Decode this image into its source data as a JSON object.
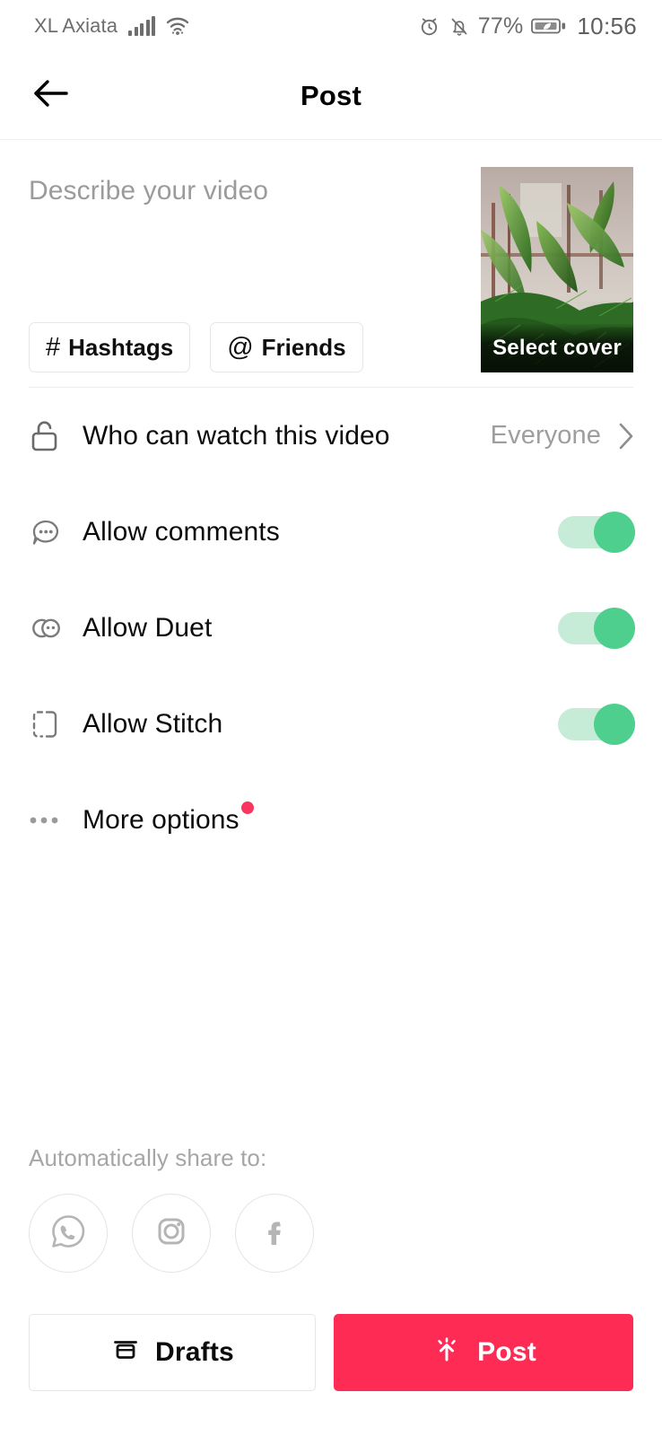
{
  "status_bar": {
    "carrier": "XL Axiata",
    "battery_percent": "77%",
    "time": "10:56",
    "icons": [
      "signal-bars-icon",
      "wifi-icon",
      "alarm-icon",
      "bell-muted-icon",
      "battery-saver-icon"
    ]
  },
  "header": {
    "title": "Post",
    "back_icon": "back-arrow-icon"
  },
  "compose": {
    "description_placeholder": "Describe your video",
    "description_value": "",
    "chips": [
      {
        "symbol": "#",
        "label": "Hashtags",
        "icon": "hashtag-icon"
      },
      {
        "symbol": "@",
        "label": "Friends",
        "icon": "at-mention-icon"
      }
    ],
    "cover": {
      "label": "Select cover",
      "icon": "video-thumbnail"
    }
  },
  "settings": {
    "rows": [
      {
        "label": "Who can watch this video",
        "icon": "unlock-icon",
        "type": "navigation",
        "value": "Everyone",
        "chevron": "chevron-right-icon"
      },
      {
        "label": "Allow comments",
        "icon": "comment-bubble-icon",
        "type": "toggle",
        "enabled": true
      },
      {
        "label": "Allow Duet",
        "icon": "duet-circles-icon",
        "type": "toggle",
        "enabled": true
      },
      {
        "label": "Allow Stitch",
        "icon": "stitch-bracket-icon",
        "type": "toggle",
        "enabled": true
      },
      {
        "label": "More options",
        "icon": "ellipsis-icon",
        "type": "navigation",
        "badge": true
      }
    ]
  },
  "share": {
    "title": "Automatically share to:",
    "targets": [
      {
        "name": "whatsapp",
        "icon": "whatsapp-icon"
      },
      {
        "name": "instagram",
        "icon": "instagram-icon"
      },
      {
        "name": "facebook",
        "icon": "facebook-icon"
      }
    ]
  },
  "footer": {
    "drafts_label": "Drafts",
    "drafts_icon": "drafts-box-icon",
    "post_label": "Post",
    "post_icon": "upload-arrow-icon"
  },
  "colors": {
    "accent_red": "#fe2c55",
    "toggle_on": "#4fcf8d",
    "toggle_track": "#c6ecd7",
    "badge_red": "#f8365e",
    "muted_text": "#9b9b9b"
  }
}
